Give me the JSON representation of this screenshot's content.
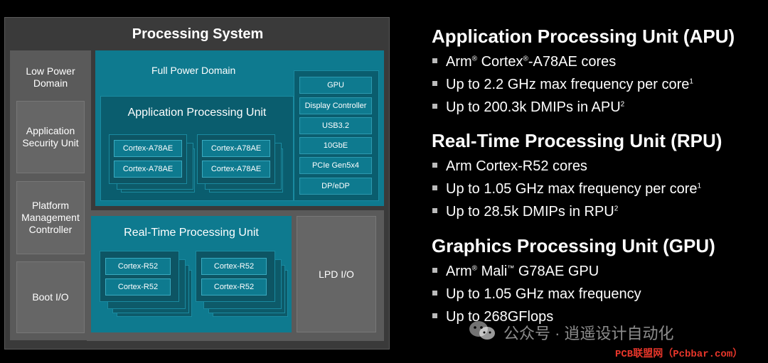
{
  "diagram": {
    "title": "Processing System",
    "lpd_label": "Low Power Domain",
    "asu_label": "Application Security Unit",
    "pmc_label": "Platform Management Controller",
    "bootio_label": "Boot I/O",
    "fpd_label": "Full Power Domain",
    "apu_label": "Application Processing Unit",
    "a78_core": "Cortex-A78AE",
    "peripherals": [
      "GPU",
      "Display Controller",
      "USB3.2",
      "10GbE",
      "PCIe Gen5x4",
      "DP/eDP"
    ],
    "rpu_label": "Real-Time Processing Unit",
    "r52_core": "Cortex-R52",
    "lpdio_label": "LPD I/O"
  },
  "specs": {
    "apu": {
      "heading": "Application Processing Unit (APU)",
      "b1_pre": "Arm",
      "b1_reg1": "®",
      "b1_mid": " Cortex",
      "b1_reg2": "®",
      "b1_post": "-A78AE cores",
      "b2": "Up to 2.2 GHz max frequency per core",
      "b2_sup": "1",
      "b3": "Up to 200.3k DMIPs in APU",
      "b3_sup": "2"
    },
    "rpu": {
      "heading": "Real-Time Processing Unit (RPU)",
      "b1": "Arm Cortex-R52 cores",
      "b2": "Up to 1.05 GHz max frequency per core",
      "b2_sup": "1",
      "b3": "Up to 28.5k DMIPs in RPU",
      "b3_sup": "2"
    },
    "gpu": {
      "heading": "Graphics Processing Unit (GPU)",
      "b1_pre": "Arm",
      "b1_reg": "®",
      "b1_post": " Mali",
      "b1_tm": "™",
      "b1_end": " G78AE GPU",
      "b2": "Up to 1.05 GHz max frequency",
      "b3": "Up to 268GFlops"
    }
  },
  "watermark": {
    "text": "公众号 · 逍遥设计自动化",
    "site": "PCB联盟网（Pcbbar.com）"
  }
}
